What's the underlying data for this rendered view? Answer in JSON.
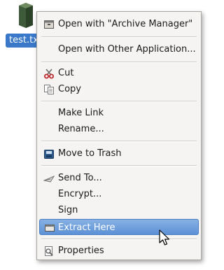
{
  "desktop": {
    "file_name": "test.tx"
  },
  "menu": {
    "items": [
      {
        "label": "Open with \"Archive Manager\"",
        "icon": "archive-icon"
      },
      {
        "label": "Open with Other Application...",
        "icon": ""
      },
      {
        "label": "Cut",
        "icon": "scissors-icon"
      },
      {
        "label": "Copy",
        "icon": "copy-icon"
      },
      {
        "label": "Make Link",
        "icon": ""
      },
      {
        "label": "Rename...",
        "icon": ""
      },
      {
        "label": "Move to Trash",
        "icon": "trash-icon"
      },
      {
        "label": "Send To...",
        "icon": "send-icon"
      },
      {
        "label": "Encrypt...",
        "icon": ""
      },
      {
        "label": "Sign",
        "icon": ""
      },
      {
        "label": "Extract Here",
        "icon": "extract-icon",
        "highlighted": true
      },
      {
        "label": "Properties",
        "icon": "properties-icon"
      }
    ]
  }
}
